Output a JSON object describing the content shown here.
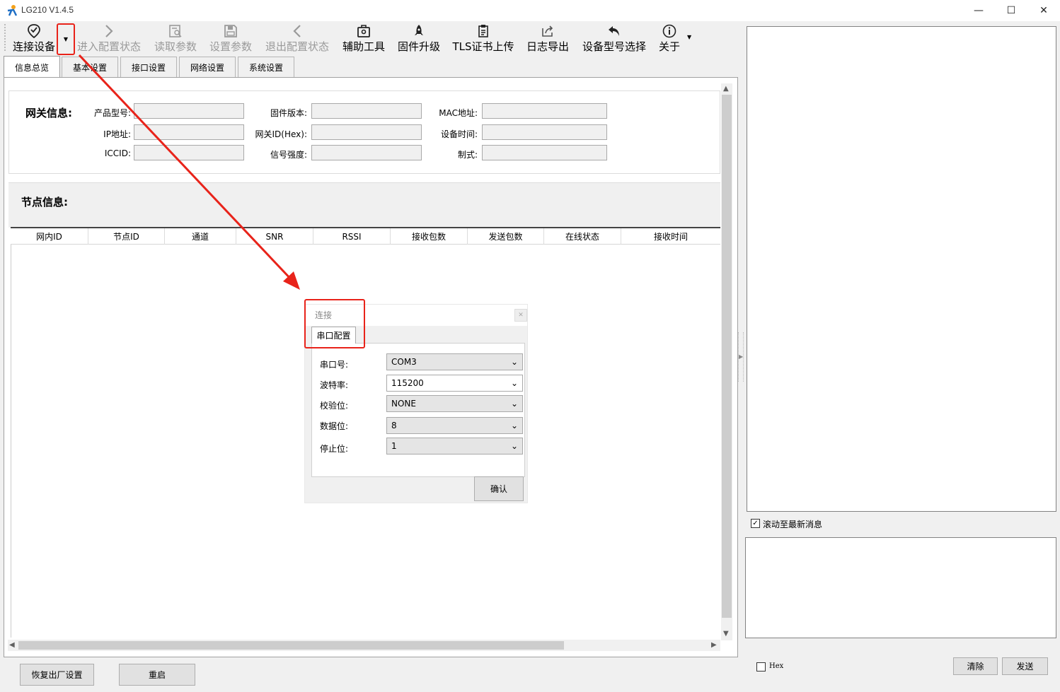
{
  "window": {
    "title": "LG210 V1.4.5"
  },
  "toolbar": {
    "connect": "连接设备",
    "enter_config": "进入配置状态",
    "read_params": "读取参数",
    "set_params": "设置参数",
    "exit_config": "退出配置状态",
    "aux_tools": "辅助工具",
    "firmware_upgrade": "固件升级",
    "tls_upload": "TLS证书上传",
    "log_export": "日志导出",
    "model_select": "设备型号选择",
    "about": "关于"
  },
  "tabs": [
    "信息总览",
    "基本设置",
    "接口设置",
    "网络设置",
    "系统设置"
  ],
  "gateway": {
    "title": "网关信息:",
    "product_model": "产品型号:",
    "ip": "IP地址:",
    "iccid": "ICCID:",
    "fw_version": "固件版本:",
    "gw_id": "网关ID(Hex):",
    "signal": "信号强度:",
    "mac": "MAC地址:",
    "device_time": "设备时间:",
    "mode": "制式:"
  },
  "nodes": {
    "title": "节点信息:",
    "columns": [
      "网内ID",
      "节点ID",
      "通道",
      "SNR",
      "RSSI",
      "接收包数",
      "发送包数",
      "在线状态",
      "接收时间"
    ]
  },
  "bottom": {
    "factory_reset": "恢复出厂设置",
    "restart": "重启"
  },
  "right": {
    "scroll_latest": "滚动至最新消息",
    "scroll_checked": "✓",
    "hex": "Hex",
    "clear": "清除",
    "send": "发送"
  },
  "dialog": {
    "title": "连接",
    "tab": "串口配置",
    "port_label": "串口号:",
    "port_value": "COM3",
    "baud_label": "波特率:",
    "baud_value": "115200",
    "parity_label": "校验位:",
    "parity_value": "NONE",
    "databits_label": "数据位:",
    "databits_value": "8",
    "stopbits_label": "停止位:",
    "stopbits_value": "1",
    "ok": "确认"
  },
  "colors": {
    "annotation_red": "#e8231a",
    "disabled_text": "#9a9a9a"
  }
}
